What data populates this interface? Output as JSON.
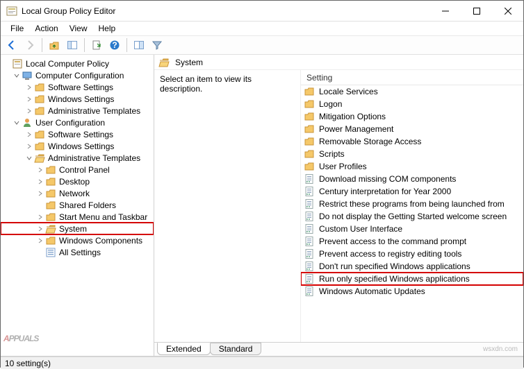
{
  "window": {
    "title": "Local Group Policy Editor"
  },
  "menu": {
    "file": "File",
    "action": "Action",
    "view": "View",
    "help": "Help"
  },
  "tree": {
    "root": "Local Computer Policy",
    "comp_config": "Computer Configuration",
    "software_settings": "Software Settings",
    "windows_settings": "Windows Settings",
    "admin_templates": "Administrative Templates",
    "user_config": "User Configuration",
    "control_panel": "Control Panel",
    "desktop": "Desktop",
    "network": "Network",
    "shared_folders": "Shared Folders",
    "start_menu_taskbar": "Start Menu and Taskbar",
    "system": "System",
    "windows_components": "Windows Components",
    "all_settings": "All Settings"
  },
  "section": {
    "title": "System",
    "description": "Select an item to view its description.",
    "setting_header": "Setting"
  },
  "settings": [
    {
      "type": "folder",
      "label": "Locale Services"
    },
    {
      "type": "folder",
      "label": "Logon"
    },
    {
      "type": "folder",
      "label": "Mitigation Options"
    },
    {
      "type": "folder",
      "label": "Power Management"
    },
    {
      "type": "folder",
      "label": "Removable Storage Access"
    },
    {
      "type": "folder",
      "label": "Scripts"
    },
    {
      "type": "folder",
      "label": "User Profiles"
    },
    {
      "type": "policy",
      "label": "Download missing COM components"
    },
    {
      "type": "policy",
      "label": "Century interpretation for Year 2000"
    },
    {
      "type": "policy",
      "label": "Restrict these programs from being launched from"
    },
    {
      "type": "policy",
      "label": "Do not display the Getting Started welcome screen"
    },
    {
      "type": "policy",
      "label": "Custom User Interface"
    },
    {
      "type": "policy",
      "label": "Prevent access to the command prompt"
    },
    {
      "type": "policy",
      "label": "Prevent access to registry editing tools"
    },
    {
      "type": "policy",
      "label": "Don't run specified Windows applications"
    },
    {
      "type": "policy",
      "label": "Run only specified Windows applications",
      "highlight": true
    },
    {
      "type": "policy",
      "label": "Windows Automatic Updates"
    }
  ],
  "tabs": {
    "extended": "Extended",
    "standard": "Standard"
  },
  "status": {
    "count": "10 setting(s)"
  },
  "watermark": {
    "brand_a": "A",
    "brand_rest": "PPUALS",
    "credit": "wsxdn.com"
  }
}
